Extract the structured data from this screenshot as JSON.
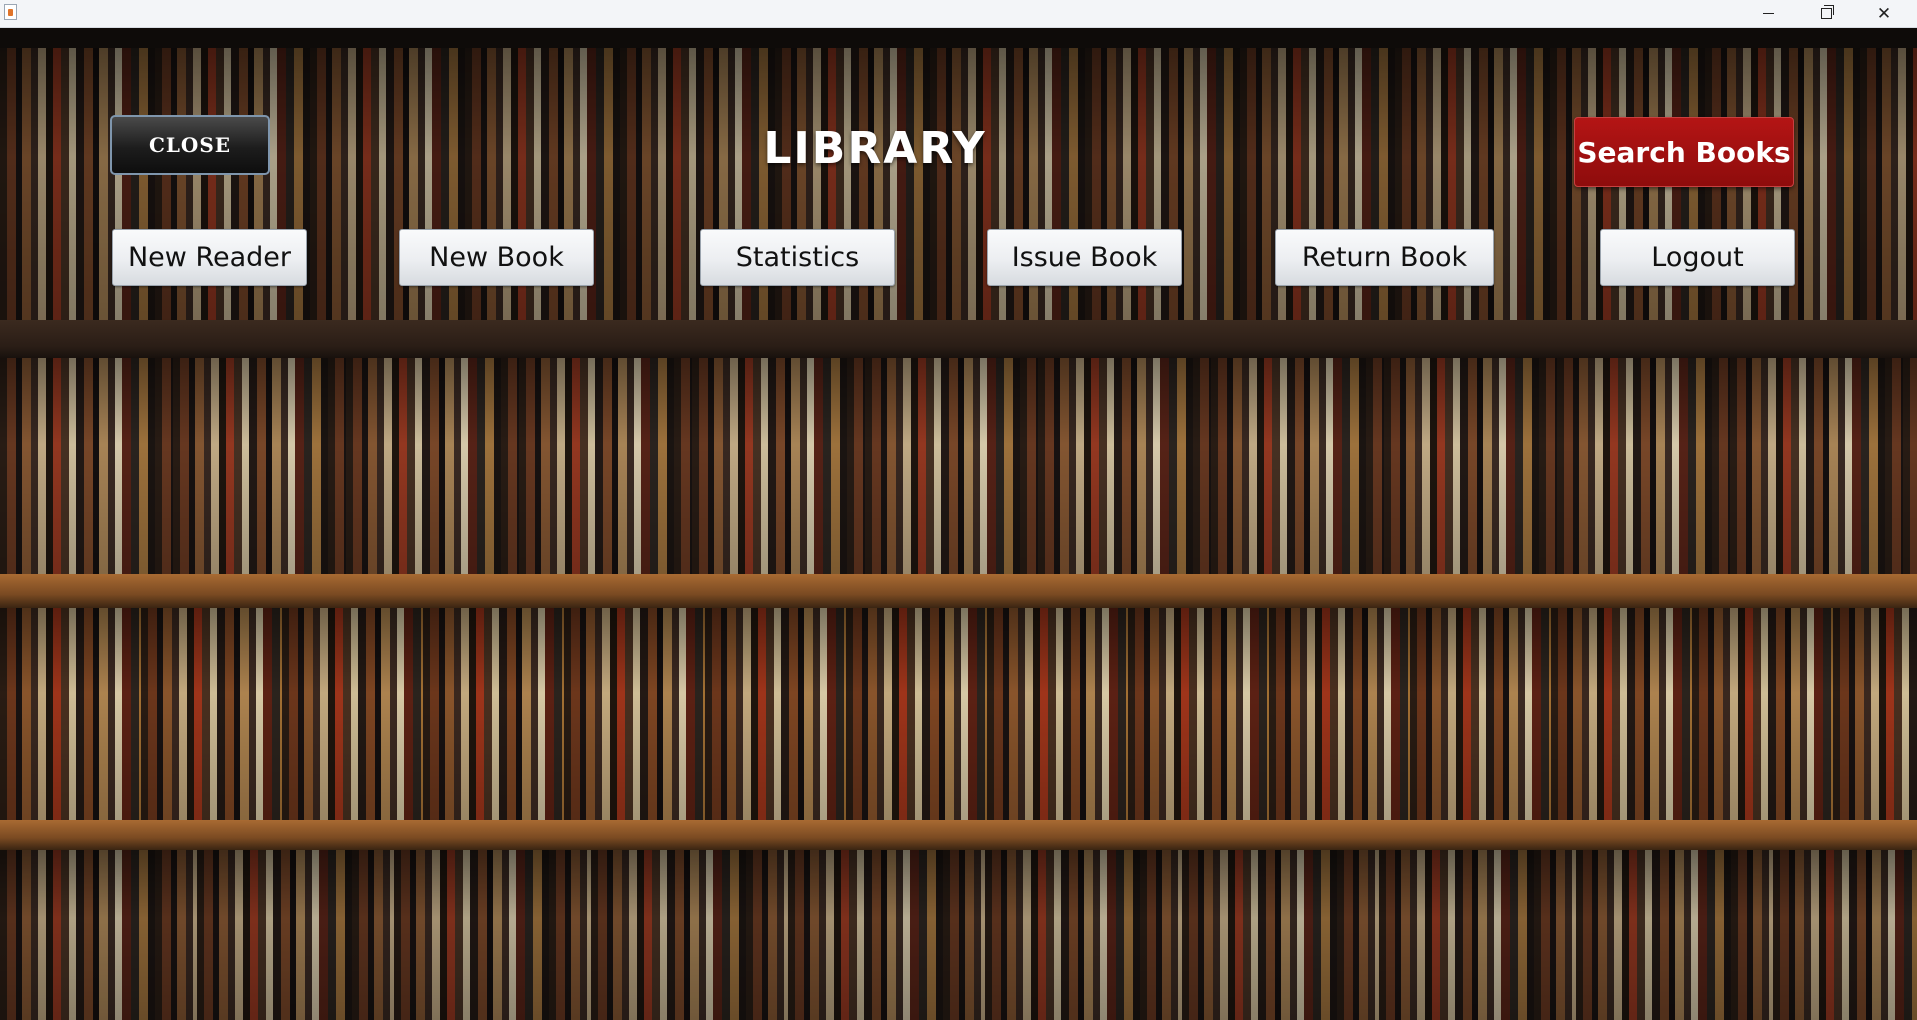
{
  "window": {
    "minimize_glyph": "",
    "close_glyph": "✕"
  },
  "header": {
    "close_label": "CLOSE",
    "title": "LIBRARY",
    "search_label": "Search Books"
  },
  "nav": {
    "new_reader": "New Reader",
    "new_book": "New Book",
    "statistics": "Statistics",
    "issue_book": "Issue Book",
    "return_book": "Return Book",
    "logout": "Logout"
  },
  "colors": {
    "search_button": "#a00f0f",
    "close_button": "#1d1d1d",
    "title_text": "#ffffff"
  },
  "icons": {
    "app": "java-app-icon",
    "minimize": "minimize-icon",
    "maximize": "restore-icon",
    "close": "close-icon"
  }
}
